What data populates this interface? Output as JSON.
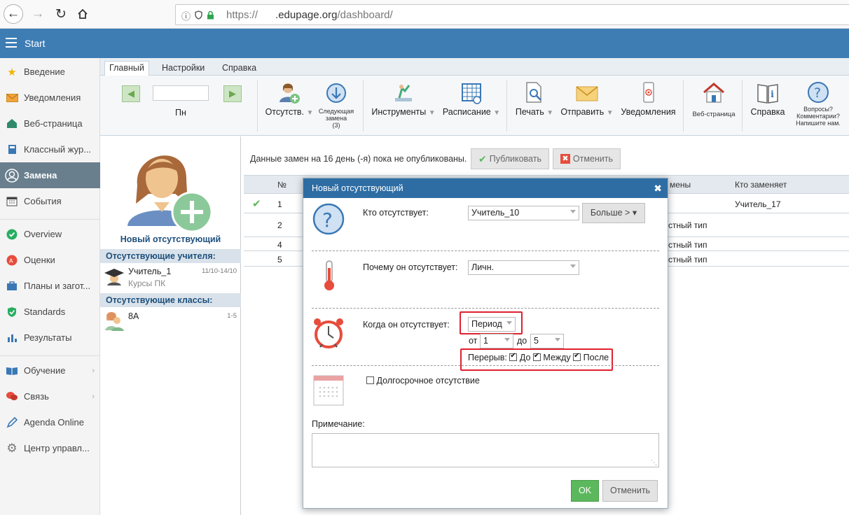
{
  "browser": {
    "url_prefix": "https://",
    "url_domain": ".edupage.org",
    "url_path": "/dashboard/"
  },
  "app": {
    "title": "Start"
  },
  "sidebar": {
    "items": [
      {
        "label": "Введение",
        "icon": "star-icon"
      },
      {
        "label": "Уведомления",
        "icon": "envelope-icon"
      },
      {
        "label": "Веб-страница",
        "icon": "house-icon"
      },
      {
        "label": "Классный жур...",
        "icon": "book-icon"
      },
      {
        "label": "Замена",
        "icon": "user-icon"
      },
      {
        "label": "События",
        "icon": "calendar-icon"
      },
      {
        "label": "Overview",
        "icon": "check-circle-icon"
      },
      {
        "label": "Оценки",
        "icon": "grade-icon"
      },
      {
        "label": "Планы и загот...",
        "icon": "briefcase-icon"
      },
      {
        "label": "Standards",
        "icon": "shield-icon"
      },
      {
        "label": "Результаты",
        "icon": "bar-chart-icon"
      },
      {
        "label": "Обучение",
        "icon": "open-book-icon"
      },
      {
        "label": "Связь",
        "icon": "chat-icon"
      },
      {
        "label": "Agenda Online",
        "icon": "pen-icon"
      },
      {
        "label": "Центр управл...",
        "icon": "gear-icon"
      }
    ]
  },
  "ribbon": {
    "tabs": [
      "Главный",
      "Настройки",
      "Справка"
    ],
    "day_label": "Пн",
    "absent_label": "Отсутств.",
    "next_sub_label_1": "Следующая",
    "next_sub_label_2": "замена",
    "next_sub_label_3": "(3)",
    "tools_label": "Инструменты",
    "schedule_label": "Расписание",
    "print_label": "Печать",
    "send_label": "Отправить",
    "notifications_label": "Уведомления",
    "webpage_label": "Веб-страница",
    "help_label": "Справка",
    "questions_1": "Вопросы?",
    "questions_2": "Комментарии?",
    "questions_3": "Напишите нам."
  },
  "left_panel": {
    "new_absent": "Новый отсутствующий",
    "absent_teachers_header": "Отсутствующие учителя:",
    "teacher_name": "Учитель_1",
    "teacher_dates": "11/10-14/10",
    "teacher_reason": "Курсы ПК",
    "absent_classes_header": "Отсутствующие классы:",
    "class_name": "8A",
    "class_periods": "1-5"
  },
  "main": {
    "notice": "Данные замен на 16 день (-я) пока не опубликованы.",
    "publish_label": "Публиковать",
    "cancel_label": "Отменить",
    "columns": {
      "num": "№",
      "type_partial": "мены",
      "who": "Кто заменяет"
    },
    "rows": [
      {
        "num": "1",
        "type": "",
        "who": "Учитель_17",
        "checked": true
      },
      {
        "num": "2",
        "type": "стный тип",
        "who": "",
        "checked": false
      },
      {
        "num": "4",
        "type": "стный тип",
        "who": "",
        "checked": false
      },
      {
        "num": "5",
        "type": "стный тип",
        "who": "",
        "checked": false
      }
    ]
  },
  "dialog": {
    "title": "Новый отсутствующий",
    "who_label": "Кто отсутствует:",
    "who_value": "Учитель_10",
    "more_label": "Больше > ▾",
    "why_label": "Почему он отсутствует:",
    "why_value": "Личн.",
    "when_label": "Когда он отсутствует:",
    "when_value": "Период",
    "from_label": "от",
    "from_value": "1",
    "to_label": "до",
    "to_value": "5",
    "break_label": "Перерыв:",
    "before_label": "До",
    "between_label": "Между",
    "after_label": "После",
    "longterm_label": "Долгосрочное отсутствие",
    "note_label": "Примечание:",
    "ok_label": "OK",
    "cancel_label": "Отменить"
  },
  "colors": {
    "appbar": "#3d7db4",
    "dialog_header": "#2e6da4",
    "highlight": "#e0202f",
    "ok": "#5cb85c"
  }
}
